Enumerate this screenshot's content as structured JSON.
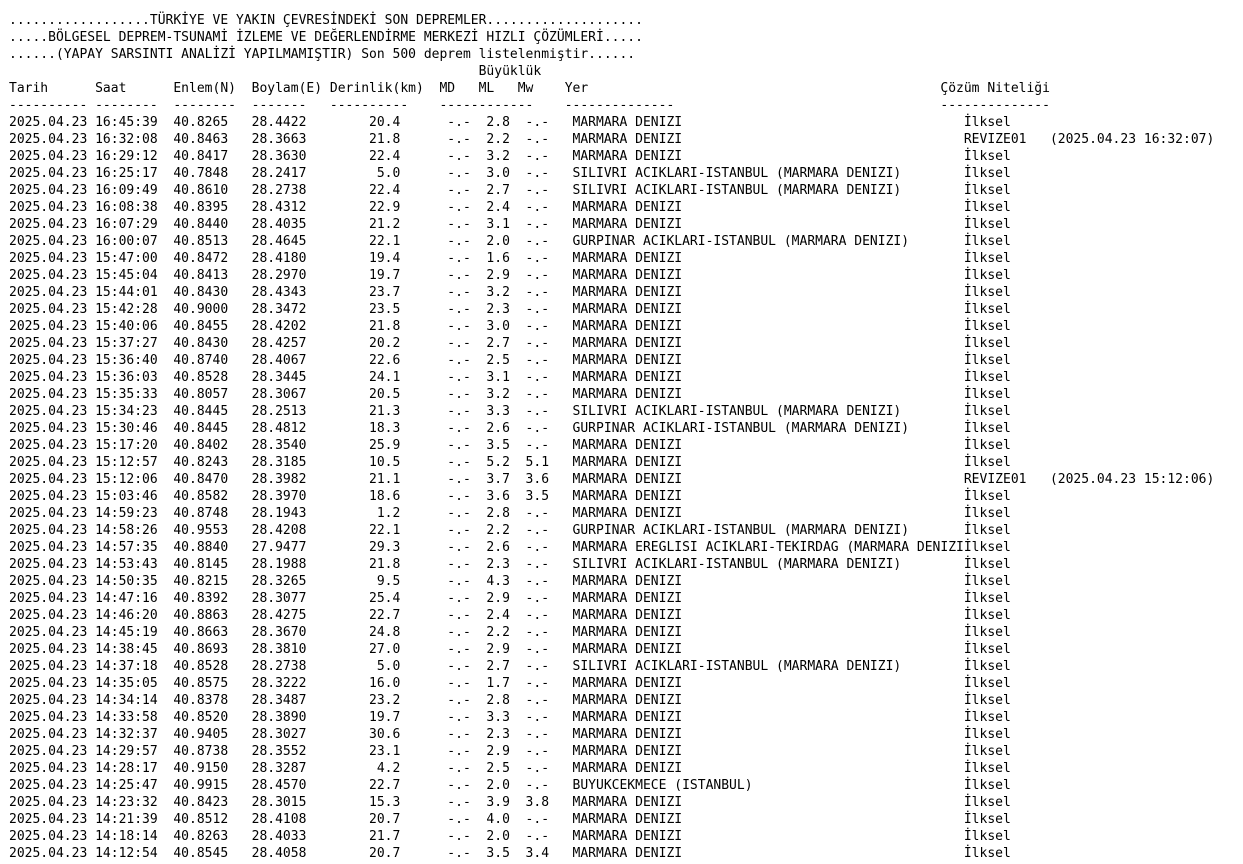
{
  "header": {
    "line1": "..................TÜRKİYE VE YAKIN ÇEVRESİNDEKİ SON DEPREMLER....................",
    "line2": ".....BÖLGESEL DEPREM-TSUNAMİ İZLEME VE DEĞERLENDİRME MERKEZİ HIZLI ÇÖZÜMLERİ.....",
    "line3": "......(YAPAY SARSINTI ANALİZİ YAPILMAMIŞTIR) Son 500 deprem listelenmiştir......",
    "line4": "                                                            Büyüklük",
    "columns": "Tarih      Saat      Enlem(N)  Boylam(E) Derinlik(km)  MD   ML   Mw    Yer                                             Çözüm Niteliği",
    "dashes": "---------- --------  --------  -------   ----------    ------------    --------------                                  --------------"
  },
  "rows": [
    "2025.04.23 16:45:39  40.8265   28.4422        20.4      -.-  2.8  -.-   MARMARA DENIZI                                    İlksel",
    "2025.04.23 16:32:08  40.8463   28.3663        21.8      -.-  2.2  -.-   MARMARA DENIZI                                    REVIZE01   (2025.04.23 16:32:07)",
    "2025.04.23 16:29:12  40.8417   28.3630        22.4      -.-  3.2  -.-   MARMARA DENIZI                                    İlksel",
    "2025.04.23 16:25:17  40.7848   28.2417         5.0      -.-  3.0  -.-   SILIVRI ACIKLARI-ISTANBUL (MARMARA DENIZI)        İlksel",
    "2025.04.23 16:09:49  40.8610   28.2738        22.4      -.-  2.7  -.-   SILIVRI ACIKLARI-ISTANBUL (MARMARA DENIZI)        İlksel",
    "2025.04.23 16:08:38  40.8395   28.4312        22.9      -.-  2.4  -.-   MARMARA DENIZI                                    İlksel",
    "2025.04.23 16:07:29  40.8440   28.4035        21.2      -.-  3.1  -.-   MARMARA DENIZI                                    İlksel",
    "2025.04.23 16:00:07  40.8513   28.4645        22.1      -.-  2.0  -.-   GURPINAR ACIKLARI-ISTANBUL (MARMARA DENIZI)       İlksel",
    "2025.04.23 15:47:00  40.8472   28.4180        19.4      -.-  1.6  -.-   MARMARA DENIZI                                    İlksel",
    "2025.04.23 15:45:04  40.8413   28.2970        19.7      -.-  2.9  -.-   MARMARA DENIZI                                    İlksel",
    "2025.04.23 15:44:01  40.8430   28.4343        23.7      -.-  3.2  -.-   MARMARA DENIZI                                    İlksel",
    "2025.04.23 15:42:28  40.9000   28.3472        23.5      -.-  2.3  -.-   MARMARA DENIZI                                    İlksel",
    "2025.04.23 15:40:06  40.8455   28.4202        21.8      -.-  3.0  -.-   MARMARA DENIZI                                    İlksel",
    "2025.04.23 15:37:27  40.8430   28.4257        20.2      -.-  2.7  -.-   MARMARA DENIZI                                    İlksel",
    "2025.04.23 15:36:40  40.8740   28.4067        22.6      -.-  2.5  -.-   MARMARA DENIZI                                    İlksel",
    "2025.04.23 15:36:03  40.8528   28.3445        24.1      -.-  3.1  -.-   MARMARA DENIZI                                    İlksel",
    "2025.04.23 15:35:33  40.8057   28.3067        20.5      -.-  3.2  -.-   MARMARA DENIZI                                    İlksel",
    "2025.04.23 15:34:23  40.8445   28.2513        21.3      -.-  3.3  -.-   SILIVRI ACIKLARI-ISTANBUL (MARMARA DENIZI)        İlksel",
    "2025.04.23 15:30:46  40.8445   28.4812        18.3      -.-  2.6  -.-   GURPINAR ACIKLARI-ISTANBUL (MARMARA DENIZI)       İlksel",
    "2025.04.23 15:17:20  40.8402   28.3540        25.9      -.-  3.5  -.-   MARMARA DENIZI                                    İlksel",
    "2025.04.23 15:12:57  40.8243   28.3185        10.5      -.-  5.2  5.1   MARMARA DENIZI                                    İlksel",
    "2025.04.23 15:12:06  40.8470   28.3982        21.1      -.-  3.7  3.6   MARMARA DENIZI                                    REVIZE01   (2025.04.23 15:12:06)",
    "2025.04.23 15:03:46  40.8582   28.3970        18.6      -.-  3.6  3.5   MARMARA DENIZI                                    İlksel",
    "2025.04.23 14:59:23  40.8748   28.1943         1.2      -.-  2.8  -.-   MARMARA DENIZI                                    İlksel",
    "2025.04.23 14:58:26  40.9553   28.4208        22.1      -.-  2.2  -.-   GURPINAR ACIKLARI-ISTANBUL (MARMARA DENIZI)       İlksel",
    "2025.04.23 14:57:35  40.8840   27.9477        29.3      -.-  2.6  -.-   MARMARA EREGLISI ACIKLARI-TEKIRDAG (MARMARA DENIZIİlksel",
    "2025.04.23 14:53:43  40.8145   28.1988        21.8      -.-  2.3  -.-   SILIVRI ACIKLARI-ISTANBUL (MARMARA DENIZI)        İlksel",
    "2025.04.23 14:50:35  40.8215   28.3265         9.5      -.-  4.3  -.-   MARMARA DENIZI                                    İlksel",
    "2025.04.23 14:47:16  40.8392   28.3077        25.4      -.-  2.9  -.-   MARMARA DENIZI                                    İlksel",
    "2025.04.23 14:46:20  40.8863   28.4275        22.7      -.-  2.4  -.-   MARMARA DENIZI                                    İlksel",
    "2025.04.23 14:45:19  40.8663   28.3670        24.8      -.-  2.2  -.-   MARMARA DENIZI                                    İlksel",
    "2025.04.23 14:38:45  40.8693   28.3810        27.0      -.-  2.9  -.-   MARMARA DENIZI                                    İlksel",
    "2025.04.23 14:37:18  40.8528   28.2738         5.0      -.-  2.7  -.-   SILIVRI ACIKLARI-ISTANBUL (MARMARA DENIZI)        İlksel",
    "2025.04.23 14:35:05  40.8575   28.3222        16.0      -.-  1.7  -.-   MARMARA DENIZI                                    İlksel",
    "2025.04.23 14:34:14  40.8378   28.3487        23.2      -.-  2.8  -.-   MARMARA DENIZI                                    İlksel",
    "2025.04.23 14:33:58  40.8520   28.3890        19.7      -.-  3.3  -.-   MARMARA DENIZI                                    İlksel",
    "2025.04.23 14:32:37  40.9405   28.3027        30.6      -.-  2.3  -.-   MARMARA DENIZI                                    İlksel",
    "2025.04.23 14:29:57  40.8738   28.3552        23.1      -.-  2.9  -.-   MARMARA DENIZI                                    İlksel",
    "2025.04.23 14:28:17  40.9150   28.3287         4.2      -.-  2.5  -.-   MARMARA DENIZI                                    İlksel",
    "2025.04.23 14:25:47  40.9915   28.4570        22.7      -.-  2.0  -.-   BUYUKCEKMECE (ISTANBUL)                           İlksel",
    "2025.04.23 14:23:32  40.8423   28.3015        15.3      -.-  3.9  3.8   MARMARA DENIZI                                    İlksel",
    "2025.04.23 14:21:39  40.8512   28.4108        20.7      -.-  4.0  -.-   MARMARA DENIZI                                    İlksel",
    "2025.04.23 14:18:14  40.8263   28.4033        21.7      -.-  2.0  -.-   MARMARA DENIZI                                    İlksel",
    "2025.04.23 14:12:54  40.8545   28.4058        20.7      -.-  3.5  3.4   MARMARA DENIZI                                    İlksel"
  ]
}
